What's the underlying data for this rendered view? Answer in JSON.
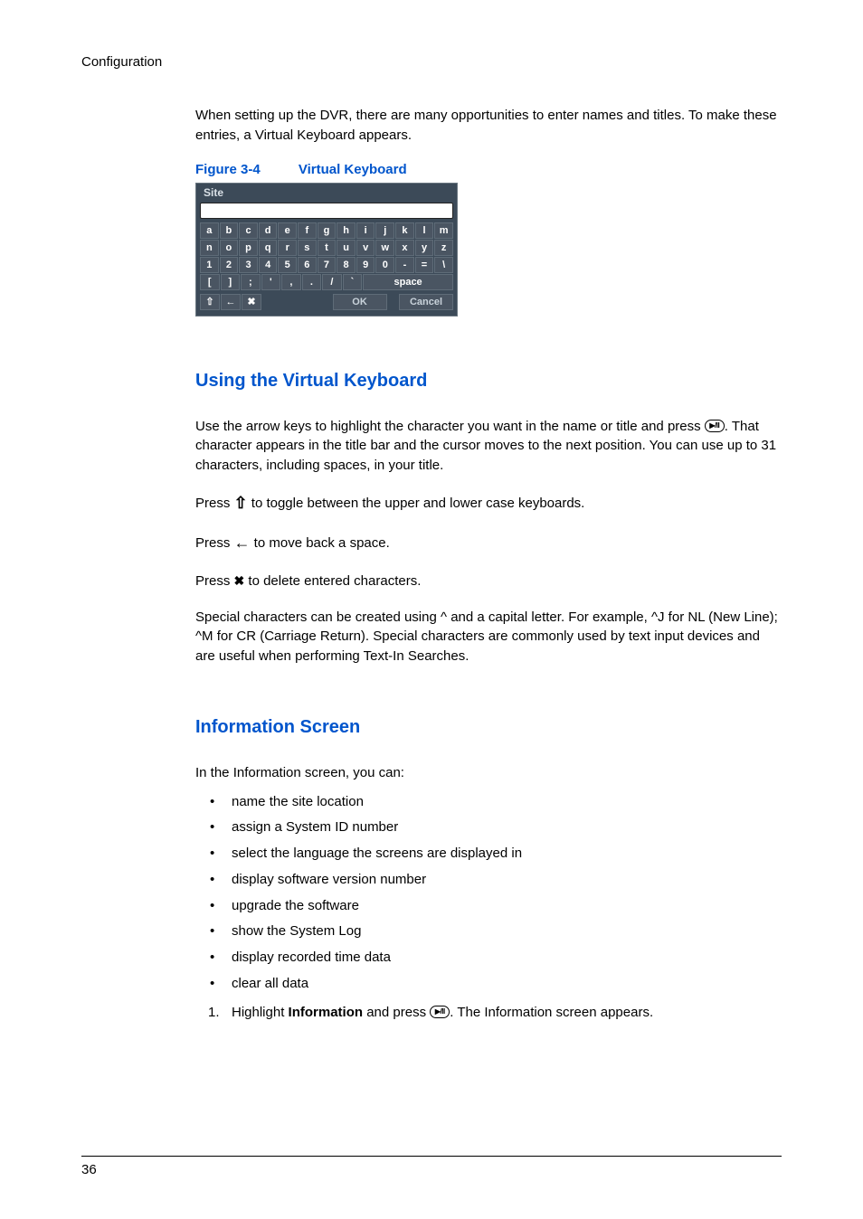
{
  "header": "Configuration",
  "intro": "When setting up the DVR, there are many opportunities to enter names and titles. To make these entries, a Virtual Keyboard appears.",
  "figure_num": "Figure 3-4",
  "figure_title": "Virtual Keyboard",
  "vk": {
    "site_label": "Site",
    "rows": {
      "r1": [
        "a",
        "b",
        "c",
        "d",
        "e",
        "f",
        "g",
        "h",
        "i",
        "j",
        "k",
        "l",
        "m"
      ],
      "r2": [
        "n",
        "o",
        "p",
        "q",
        "r",
        "s",
        "t",
        "u",
        "v",
        "w",
        "x",
        "y",
        "z"
      ],
      "r3": [
        "1",
        "2",
        "3",
        "4",
        "5",
        "6",
        "7",
        "8",
        "9",
        "0",
        "-",
        "=",
        "\\"
      ],
      "r4": [
        "[",
        "]",
        ";",
        "'",
        ",",
        ".",
        "/",
        "`"
      ]
    },
    "space_label": "space",
    "ok_label": "OK",
    "cancel_label": "Cancel",
    "shift_glyph": "⇧",
    "back_glyph": "←",
    "del_glyph": "✖"
  },
  "h2_virtual_kb": "Using the Virtual Keyboard",
  "vk_use_p1a": "Use the arrow keys to highlight the character you want in the name or title and press ",
  "vk_use_p1b": ". That character appears in the title bar and the cursor moves to the next position. You can use up to 31 characters, including spaces, in your title.",
  "vk_press_shift_a": "Press ",
  "vk_press_shift_b": " to toggle between the upper and lower case keyboards.",
  "vk_press_back_a": "Press ",
  "vk_press_back_b": " to move back a space.",
  "vk_press_del_a": "Press ",
  "vk_press_del_b": " to delete entered characters.",
  "vk_special": "Special characters can be created using ^ and a capital letter. For example, ^J for NL (New Line); ^M for CR (Carriage Return). Special characters are commonly used by text input devices and are useful when performing Text-In Searches.",
  "h2_info_screen": "Information Screen",
  "info_intro": "In the Information screen, you can:",
  "info_bullets": [
    "name the site location",
    "assign a System ID number",
    "select the language the screens are displayed in",
    "display software version number",
    "upgrade the software",
    "show the System Log",
    "display recorded time data",
    "clear all data"
  ],
  "step1_num": "1.",
  "step1_a": "Highlight ",
  "step1_bold": "Information",
  "step1_b": " and press ",
  "step1_c": ". The Information screen appears.",
  "enter_label": "▶/II",
  "shift_inline": "⇧",
  "back_inline": "←",
  "del_inline": "✖",
  "page_number": "36"
}
